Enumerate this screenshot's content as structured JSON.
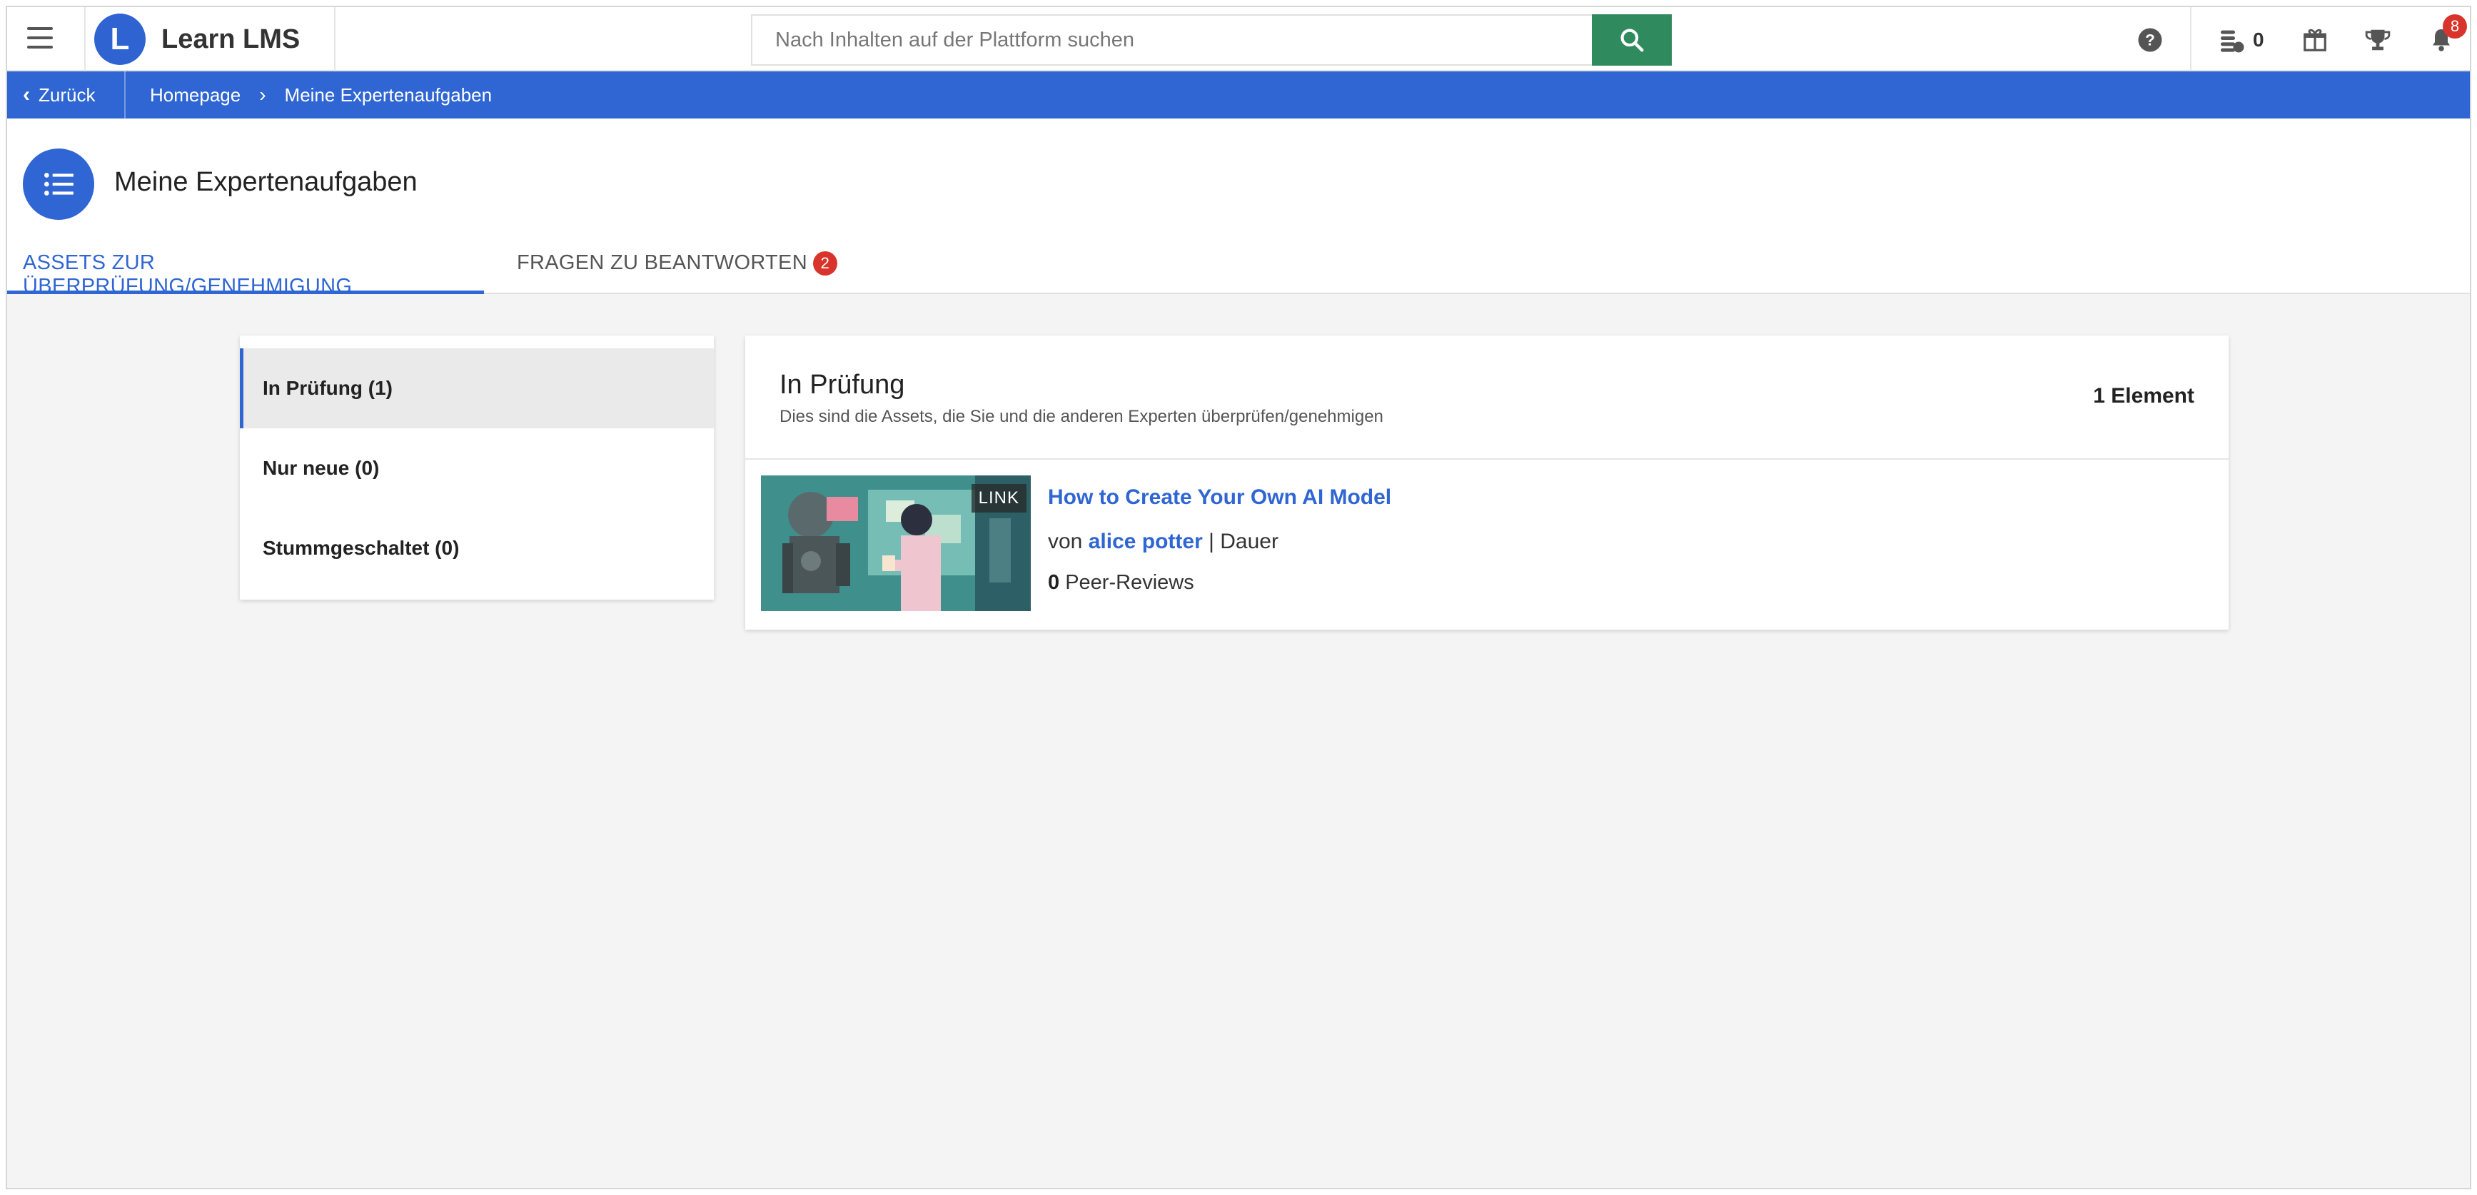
{
  "app": {
    "name": "Learn LMS",
    "logo_letter": "L"
  },
  "search": {
    "placeholder": "Nach Inhalten auf der Plattform suchen",
    "value": ""
  },
  "topbar": {
    "coins": "0",
    "notifications": "8"
  },
  "breadcrumb": {
    "back_label": "Zurück",
    "items": [
      "Homepage",
      "Meine Expertenaufgaben"
    ]
  },
  "page": {
    "title": "Meine Expertenaufgaben"
  },
  "tabs": [
    {
      "label": "ASSETS ZUR ÜBERPRÜFUNG/GENEHMIGUNG",
      "active": true
    },
    {
      "label": "FRAGEN ZU BEANTWORTEN",
      "badge": "2",
      "active": false
    }
  ],
  "filters": [
    {
      "label": "In Prüfung (1)",
      "active": true
    },
    {
      "label": "Nur neue (0)",
      "active": false
    },
    {
      "label": "Stummgeschaltet (0)",
      "active": false
    }
  ],
  "list": {
    "title": "In Prüfung",
    "subtitle": "Dies sind die Assets, die Sie und die anderen Experten überprüfen/genehmigen",
    "count": "1 Element",
    "items": [
      {
        "badge": "LINK",
        "title": "How to Create Your Own AI Model",
        "by_prefix": "von",
        "author": "alice potter",
        "duration_sep": "|",
        "duration_label": "Dauer",
        "reviews_count": "0",
        "reviews_label": "Peer-Reviews"
      }
    ]
  },
  "colors": {
    "brand_blue": "#2f66d3",
    "search_green": "#2f8a5d",
    "badge_red": "#d9342b"
  }
}
